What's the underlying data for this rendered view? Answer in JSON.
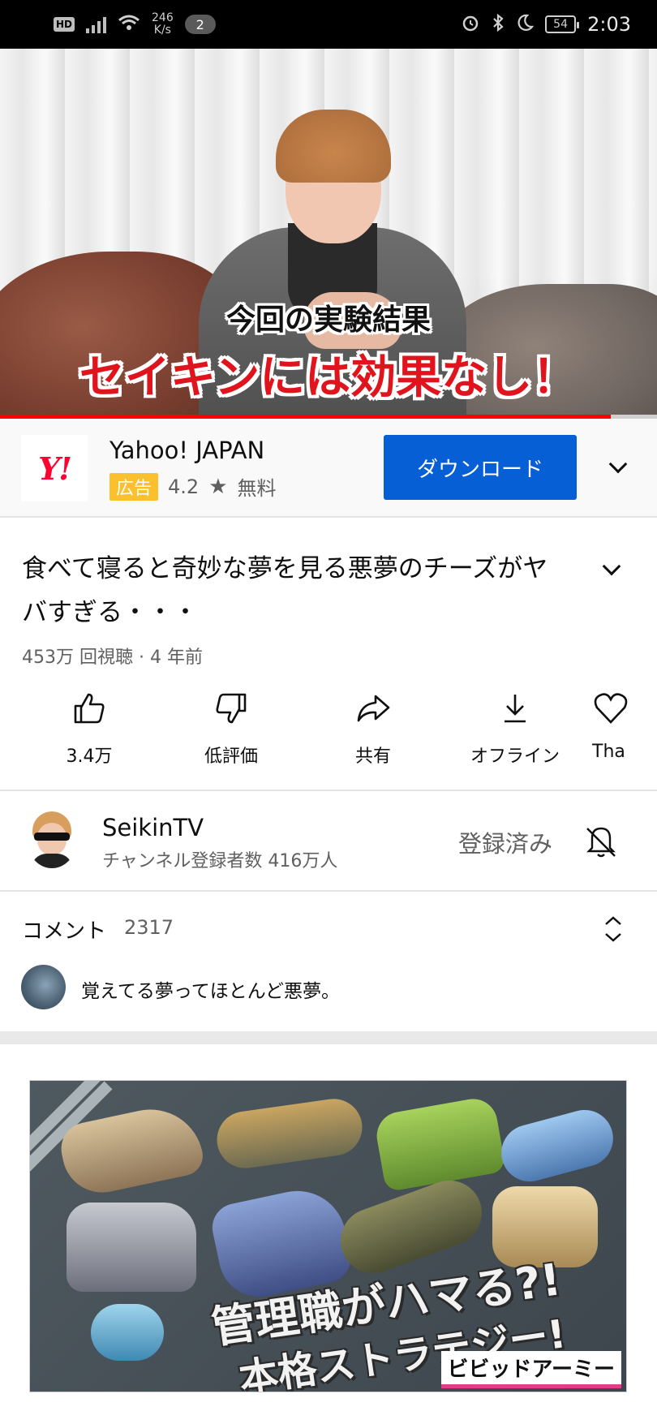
{
  "status_bar": {
    "hd": "HD",
    "speed_value": "246",
    "speed_unit": "K/s",
    "notification_count": "2",
    "battery": "54",
    "time": "2:03"
  },
  "player": {
    "caption_line1": "今回の実験結果",
    "caption_line2": "セイキンには効果なし！",
    "progress": 0.93
  },
  "ad": {
    "logo_text": "Y!",
    "title": "Yahoo! JAPAN",
    "badge": "広告",
    "rating": "4.2",
    "price": "無料",
    "cta": "ダウンロード"
  },
  "video": {
    "title": "食べて寝ると奇妙な夢を見る悪夢のチーズがヤバすぎる・・・",
    "meta": "453万 回視聴 · 4 年前"
  },
  "actions": [
    {
      "label": "3.4万",
      "icon": "thumbs-up-icon"
    },
    {
      "label": "低評価",
      "icon": "thumbs-down-icon"
    },
    {
      "label": "共有",
      "icon": "share-icon"
    },
    {
      "label": "オフライン",
      "icon": "download-icon"
    },
    {
      "label": "Tha",
      "icon": "thanks-icon"
    }
  ],
  "channel": {
    "name": "SeikinTV",
    "subscribers": "チャンネル登録者数 416万人",
    "subscribed_label": "登録済み"
  },
  "comments": {
    "label": "コメント",
    "count": "2317",
    "top_comment": "覚えてる夢ってほとんど悪夢。"
  },
  "banner": {
    "line1": "管理職がハマる?!",
    "line2": "本格ストラテジー!",
    "brand": "ビビッドアーミー"
  },
  "colors": {
    "accent": "#065fd4",
    "progress": "#ff0000",
    "ad_badge": "#fbc02d",
    "logo_red": "#ff0033"
  }
}
